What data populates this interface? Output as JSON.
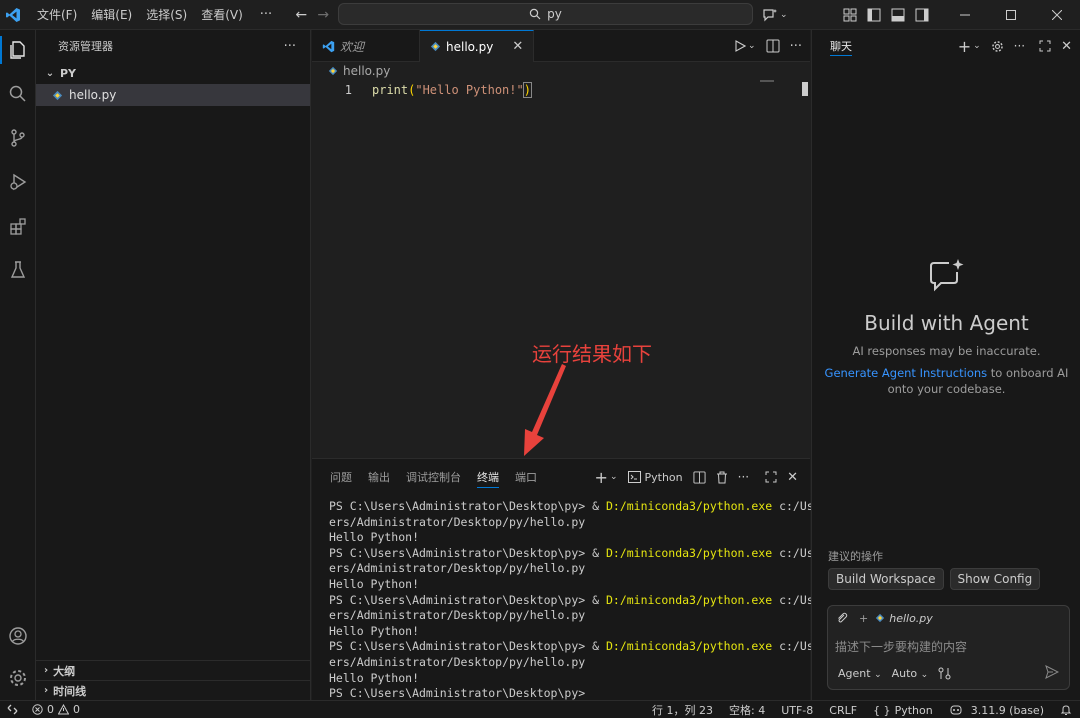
{
  "titlebar": {
    "menus": [
      "文件(F)",
      "编辑(E)",
      "选择(S)",
      "查看(V)"
    ],
    "more": "···",
    "search_text": "py"
  },
  "sidebar": {
    "title": "资源管理器",
    "more": "···",
    "folder": "PY",
    "file": "hello.py",
    "outline": "大纲",
    "timeline": "时间线"
  },
  "editor": {
    "tabs": [
      {
        "label": "欢迎",
        "active": false
      },
      {
        "label": "hello.py",
        "active": true
      }
    ],
    "breadcrumb": "hello.py",
    "line_number": "1",
    "code": {
      "fn": "print",
      "open": "(",
      "str": "\"Hello Python!\"",
      "close": ")"
    }
  },
  "annotation": "运行结果如下",
  "panel": {
    "tabs": [
      "问题",
      "输出",
      "调试控制台",
      "终端",
      "端口"
    ],
    "active_tab": "终端",
    "shell_label": "Python",
    "terminal": {
      "prompt": "PS C:\\Users\\Administrator\\Desktop\\py> ",
      "cmd_amp": "& ",
      "exe": "D:/miniconda3/python.exe",
      "arg_head": " c:/Us",
      "arg_tail": "ers/Administrator/Desktop/py/hello.py",
      "output": "Hello Python!",
      "runs": 4
    }
  },
  "chat": {
    "title": "聊天",
    "heading": "Build with Agent",
    "disclaimer": "AI responses may be inaccurate.",
    "link": "Generate Agent Instructions",
    "onboard_tail": " to onboard AI",
    "onboard_line2": "onto your codebase.",
    "suggest_label": "建议的操作",
    "suggestions": [
      "Build Workspace",
      "Show Config"
    ],
    "context_file": "hello.py",
    "input_placeholder": "描述下一步要构建的内容",
    "mode": "Agent",
    "model": "Auto"
  },
  "statusbar": {
    "errors": "0",
    "warnings": "0",
    "position": "行 1，列 23",
    "spaces": "空格: 4",
    "encoding": "UTF-8",
    "eol": "CRLF",
    "language": "Python",
    "interpreter": "3.11.9 (base)"
  },
  "colors": {
    "accent": "#0078d4",
    "annotation_red": "#e8423c",
    "exe_yellow": "#e5e510",
    "link_blue": "#3794ff"
  }
}
